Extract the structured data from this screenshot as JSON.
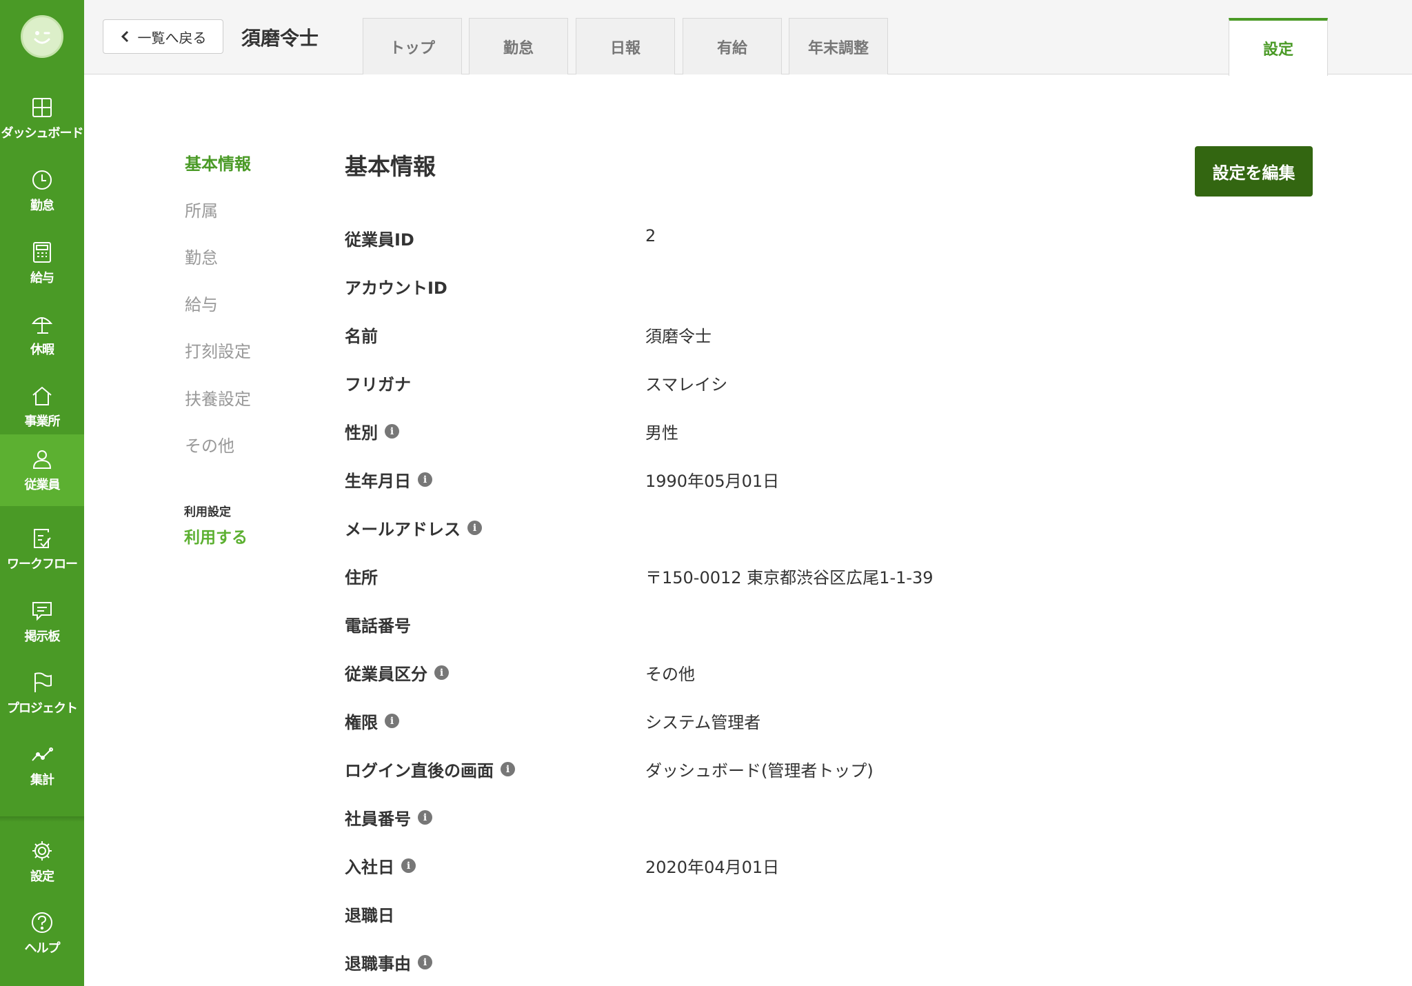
{
  "sidebar": {
    "items": [
      {
        "label": "ダッシュボード",
        "icon": "dashboard-icon"
      },
      {
        "label": "勤怠",
        "icon": "clock-icon"
      },
      {
        "label": "給与",
        "icon": "calculator-icon"
      },
      {
        "label": "休暇",
        "icon": "parasol-icon"
      },
      {
        "label": "事業所",
        "icon": "home-icon"
      },
      {
        "label": "従業員",
        "icon": "person-icon"
      },
      {
        "label": "ワークフロー",
        "icon": "checklist-icon"
      },
      {
        "label": "掲示板",
        "icon": "chat-icon"
      },
      {
        "label": "プロジェクト",
        "icon": "flag-icon"
      },
      {
        "label": "集計",
        "icon": "trend-icon"
      }
    ],
    "bottom_items": [
      {
        "label": "設定",
        "icon": "gear-icon"
      },
      {
        "label": "ヘルプ",
        "icon": "help-icon"
      }
    ],
    "active_item": "従業員",
    "accent_color": "#4a9a26"
  },
  "header": {
    "back_label": "一覧へ戻る",
    "employee_name": "須磨令士",
    "tabs": [
      "トップ",
      "勤怠",
      "日報",
      "有給",
      "年末調整"
    ],
    "settings_tab": "設定"
  },
  "subnav": {
    "items": [
      "基本情報",
      "所属",
      "勤怠",
      "給与",
      "打刻設定",
      "扶養設定",
      "その他"
    ],
    "active": "基本情報",
    "usage_title": "利用設定",
    "usage_value": "利用する"
  },
  "main": {
    "title": "基本情報",
    "edit_button": "設定を編集",
    "fields": [
      {
        "label": "従業員ID",
        "value": "2",
        "info": false
      },
      {
        "label": "アカウントID",
        "value": "",
        "info": false
      },
      {
        "label": "名前",
        "value": "須磨令士",
        "info": false
      },
      {
        "label": "フリガナ",
        "value": "スマレイシ",
        "info": false
      },
      {
        "label": "性別",
        "value": "男性",
        "info": true
      },
      {
        "label": "生年月日",
        "value": "1990年05月01日",
        "info": true
      },
      {
        "label": "メールアドレス",
        "value": "",
        "info": true
      },
      {
        "label": "住所",
        "value": "〒150-0012 東京都渋谷区広尾1-1-39",
        "info": false
      },
      {
        "label": "電話番号",
        "value": "",
        "info": false
      },
      {
        "label": "従業員区分",
        "value": "その他",
        "info": true
      },
      {
        "label": "権限",
        "value": "システム管理者",
        "info": true
      },
      {
        "label": "ログイン直後の画面",
        "value": "ダッシュボード(管理者トップ)",
        "info": true
      },
      {
        "label": "社員番号",
        "value": "",
        "info": true
      },
      {
        "label": "入社日",
        "value": "2020年04月01日",
        "info": true
      },
      {
        "label": "退職日",
        "value": "",
        "info": false
      },
      {
        "label": "退職事由",
        "value": "",
        "info": true
      }
    ]
  }
}
